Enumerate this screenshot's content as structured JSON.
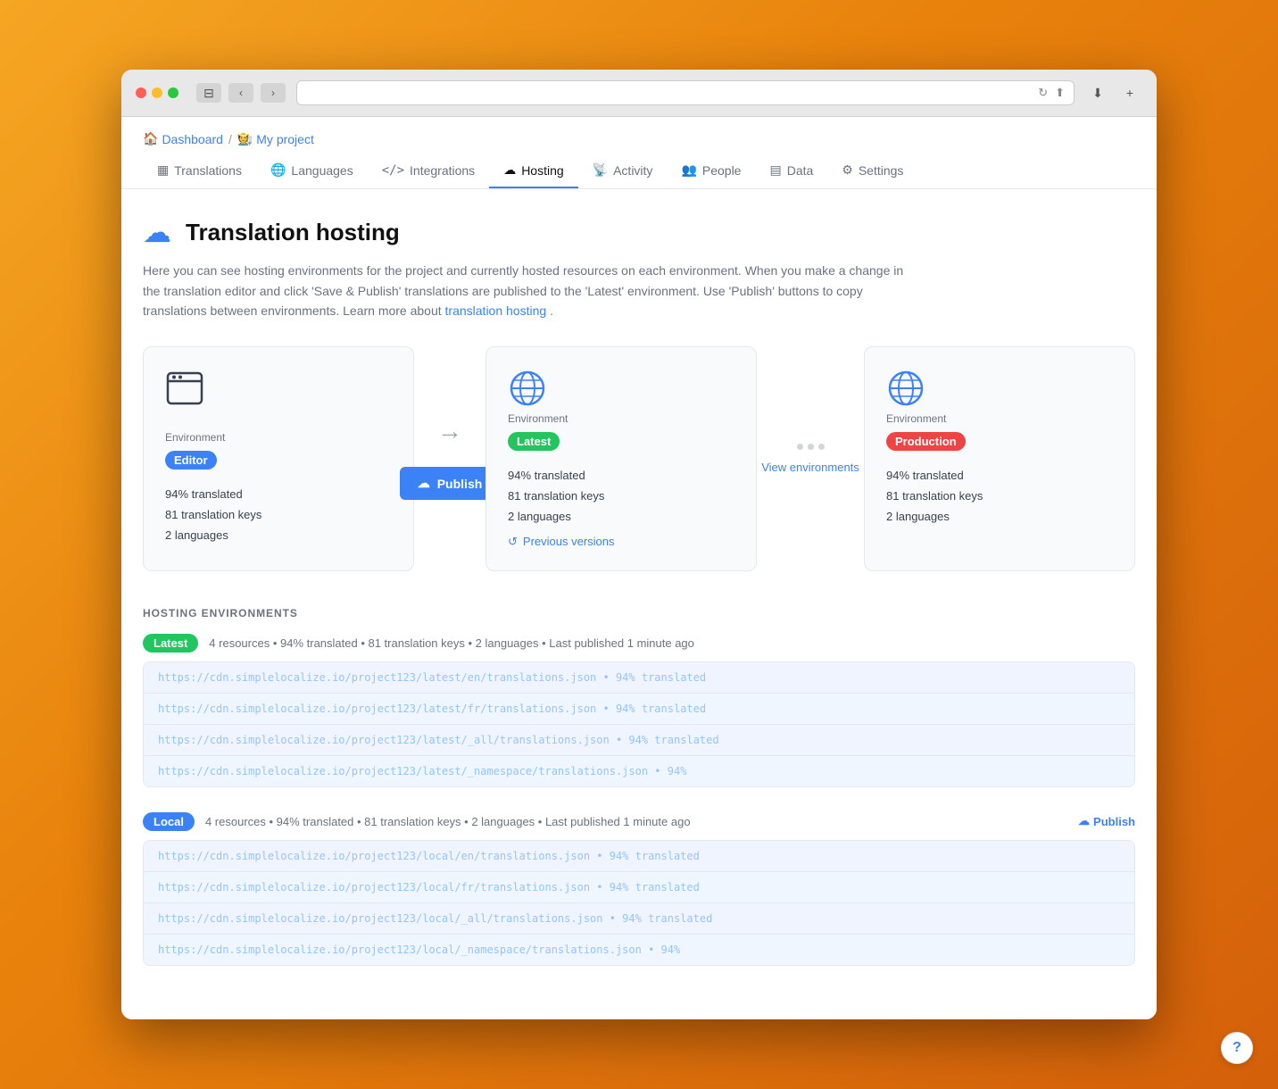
{
  "browser": {
    "tl_red": "red",
    "tl_yellow": "yellow",
    "tl_green": "green"
  },
  "breadcrumb": {
    "dashboard_label": "Dashboard",
    "separator": "/",
    "project_label": "My project"
  },
  "nav": {
    "tabs": [
      {
        "id": "translations",
        "label": "Translations",
        "icon": "▦",
        "active": false
      },
      {
        "id": "languages",
        "label": "Languages",
        "icon": "🌐",
        "active": false
      },
      {
        "id": "integrations",
        "label": "Integrations",
        "icon": "</>",
        "active": false
      },
      {
        "id": "hosting",
        "label": "Hosting",
        "icon": "☁",
        "active": true
      },
      {
        "id": "activity",
        "label": "Activity",
        "icon": "📡",
        "active": false
      },
      {
        "id": "people",
        "label": "People",
        "icon": "👥",
        "active": false
      },
      {
        "id": "data",
        "label": "Data",
        "icon": "▤",
        "active": false
      },
      {
        "id": "settings",
        "label": "Settings",
        "icon": "⚙",
        "active": false
      }
    ]
  },
  "page": {
    "title": "Translation hosting",
    "description": "Here you can see hosting environments for the project and currently hosted resources on each environment. When you make a change in the translation editor and click 'Save & Publish' translations are published to the 'Latest' environment. Use 'Publish' buttons to copy translations between environments. Learn more about",
    "description_link": "translation hosting",
    "description_end": "."
  },
  "environments": {
    "editor": {
      "label": "Environment",
      "badge": "Editor",
      "stats": {
        "translated": "94% translated",
        "keys": "81 translation keys",
        "languages": "2 languages"
      }
    },
    "arrow": "→",
    "publish_btn": "Publish",
    "latest": {
      "label": "Environment",
      "badge": "Latest",
      "stats": {
        "translated": "94% translated",
        "keys": "81 translation keys",
        "languages": "2 languages"
      },
      "prev_versions": "Previous versions"
    },
    "view_environments": "View environments",
    "production": {
      "label": "Environment",
      "badge": "Production",
      "stats": {
        "translated": "94% translated",
        "keys": "81 translation keys",
        "languages": "2 languages"
      }
    }
  },
  "hosting_section": {
    "title": "HOSTING ENVIRONMENTS",
    "latest": {
      "badge": "Latest",
      "meta": "4 resources  •  94% translated  •  81 translation keys  •  2 languages  •  Last published 1 minute ago",
      "rows": [
        "https://cdn.simplelocalize.io/project123/latest/en/translations.json • 94% translated",
        "https://cdn.simplelocalize.io/project123/latest/fr/translations.json • 94% translated",
        "https://cdn.simplelocalize.io/project123/latest/_all/translations.json • 94% translated",
        "https://cdn.simplelocalize.io/project123/latest/_namespace/translations.json • 94%"
      ]
    },
    "local": {
      "badge": "Local",
      "meta": "4 resources  •  94% translated  •  81 translation keys  •  2 languages  •  Last published 1 minute ago",
      "publish_label": "Publish",
      "rows": [
        "https://cdn.simplelocalize.io/project123/local/en/translations.json • 94% translated",
        "https://cdn.simplelocalize.io/project123/local/fr/translations.json • 94% translated",
        "https://cdn.simplelocalize.io/project123/local/_all/translations.json • 94% translated",
        "https://cdn.simplelocalize.io/project123/local/_namespace/translations.json • 94%"
      ]
    }
  },
  "help": {
    "label": "?"
  }
}
